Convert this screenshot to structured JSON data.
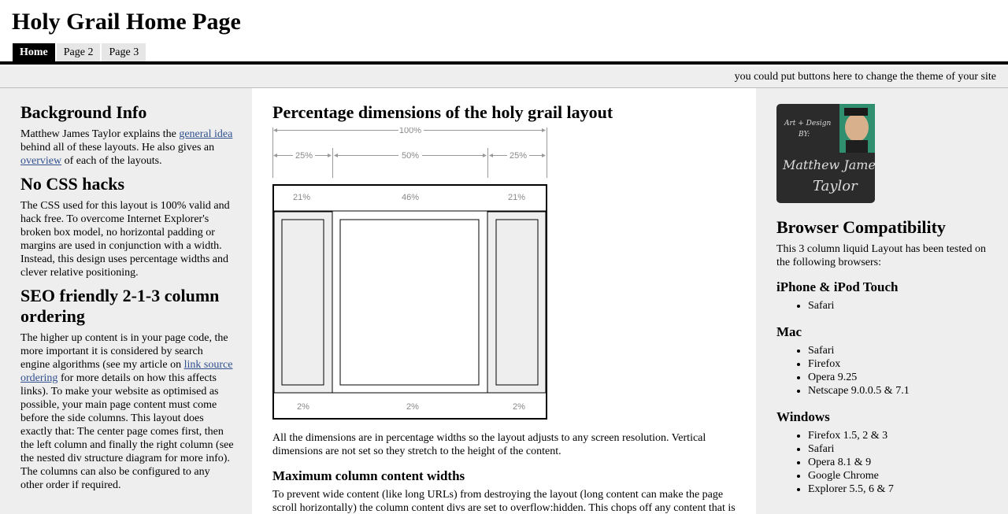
{
  "header": {
    "title": "Holy Grail Home Page",
    "tabs": [
      {
        "label": "Home"
      },
      {
        "label": "Page 2"
      },
      {
        "label": "Page 3"
      }
    ],
    "theme_text": "you could put buttons here to change the theme of your site"
  },
  "left": {
    "sections": [
      {
        "heading": "Background Info",
        "p_before": "Matthew James Taylor explains the ",
        "link1": "general idea",
        "p_mid": " behind all of these layouts. He also gives an ",
        "link2": "overview",
        "p_after": " of each of the layouts."
      },
      {
        "heading": "No CSS hacks",
        "text": "The CSS used for this layout is 100% valid and hack free. To overcome Internet Explorer's broken box model, no horizontal padding or margins are used in conjunction with a width. Instead, this design uses percentage widths and clever relative positioning."
      },
      {
        "heading": "SEO friendly 2-1-3 column ordering",
        "p_before": "The higher up content is in your page code, the more important it is considered by search engine algorithms (see my article on ",
        "link": "link source ordering",
        "p_after": " for more details on how this affects links). To make your website as optimised as possible, your main page content must come before the side columns. This layout does exactly that: The center page comes first, then the left column and finally the right column (see the nested div structure diagram for more info). The columns can also be configured to any other order if required."
      }
    ]
  },
  "main": {
    "heading": "Percentage dimensions of the holy grail layout",
    "diagram": {
      "outer": [
        "100%"
      ],
      "columns": [
        "25%",
        "50%",
        "25%"
      ],
      "content": [
        "21%",
        "46%",
        "21%"
      ],
      "gaps": [
        "2%",
        "2%",
        "2%"
      ]
    },
    "paragraph": "All the dimensions are in percentage widths so the layout adjusts to any screen resolution. Vertical dimensions are not set so they stretch to the height of the content.",
    "subheading": "Maximum column content widths",
    "paragraph2": "To prevent wide content (like long URLs) from destroying the layout (long content can make the page scroll horizontally) the column content divs are set to overflow:hidden. This chops off any content that is wider than the div."
  },
  "right": {
    "image_text": [
      "Art + Design",
      "BY:",
      "Matthew James",
      "Taylor"
    ],
    "heading": "Browser Compatibility",
    "intro": "This 3 column liquid Layout has been tested on the following browsers:",
    "groups": [
      {
        "title": "iPhone & iPod Touch",
        "items": [
          "Safari"
        ]
      },
      {
        "title": "Mac",
        "items": [
          "Safari",
          "Firefox",
          "Opera 9.25",
          "Netscape 9.0.0.5 & 7.1"
        ]
      },
      {
        "title": "Windows",
        "items": [
          "Firefox 1.5, 2 & 3",
          "Safari",
          "Opera 8.1 & 9",
          "Google Chrome",
          "Explorer 5.5, 6 & 7"
        ]
      }
    ]
  },
  "colors": {
    "side_bg": "#eeeeee",
    "tab_active": "#000000",
    "tab_bg": "#e6e6e6",
    "link": "#2f4f8f"
  }
}
